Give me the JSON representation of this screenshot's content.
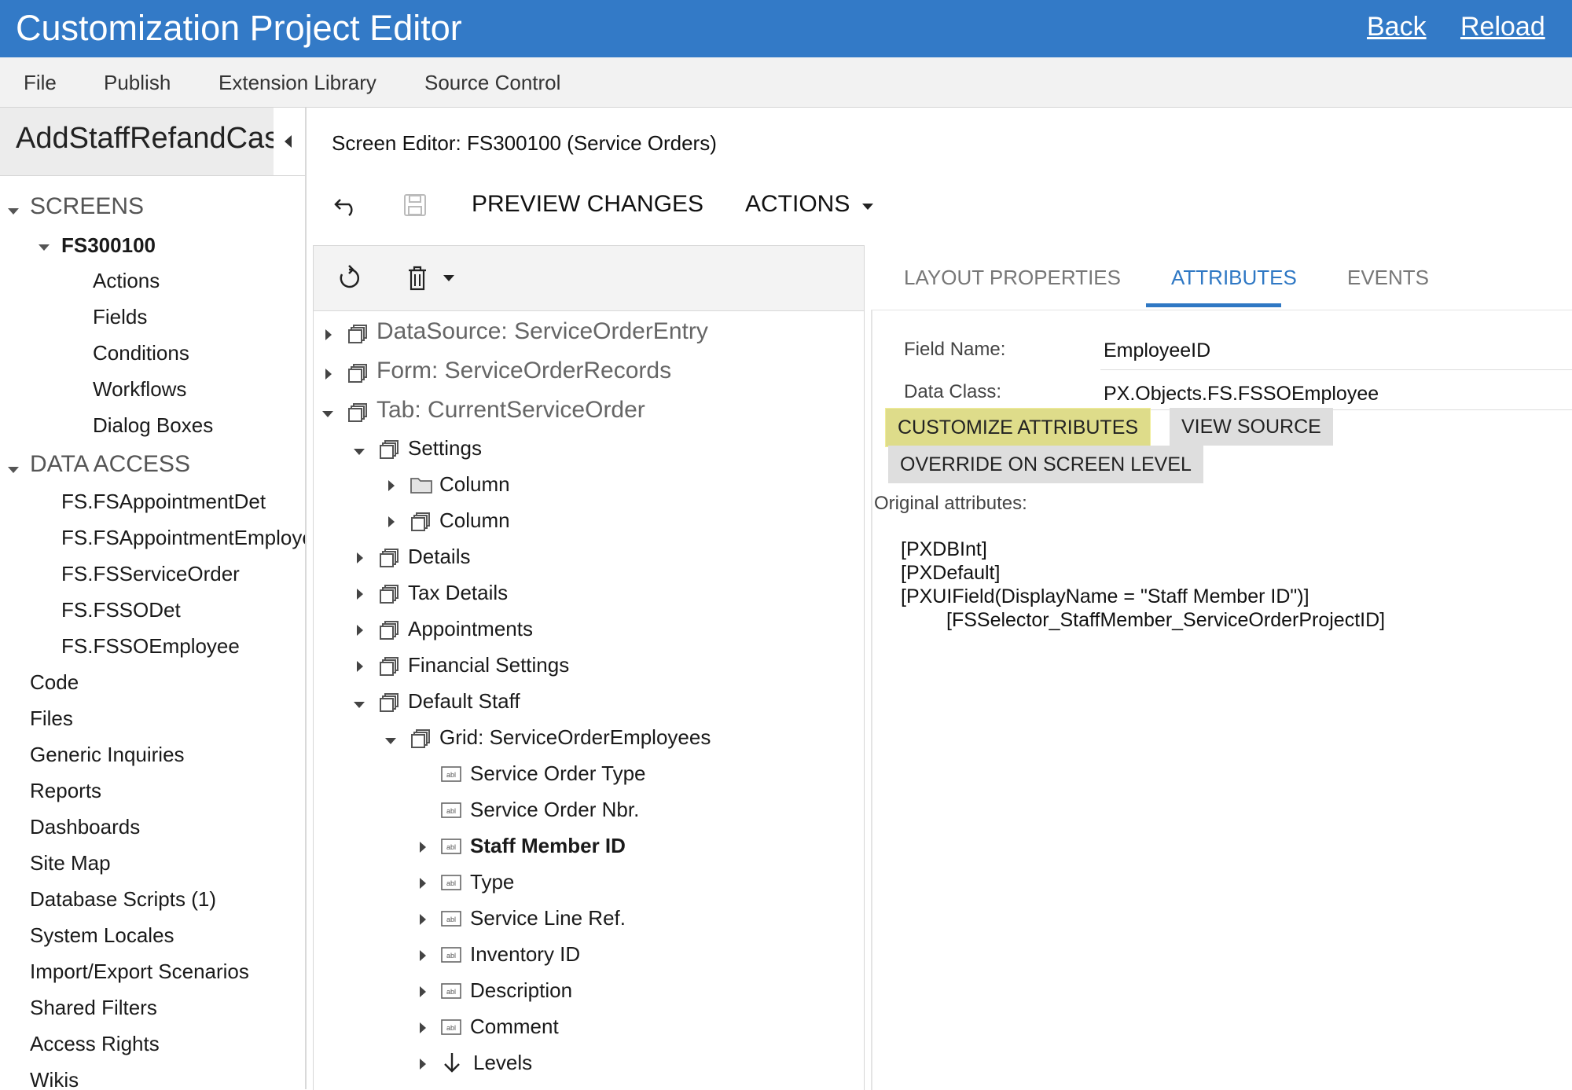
{
  "header": {
    "title": "Customization Project Editor",
    "back_label": "Back",
    "reload_label": "Reload"
  },
  "menu": {
    "items": [
      "File",
      "Publish",
      "Extension Library",
      "Source Control"
    ]
  },
  "left_panel": {
    "project_name": "AddStaffRefandCase",
    "screens_label": "SCREENS",
    "screen_id": "FS300100",
    "screen_children": [
      "Actions",
      "Fields",
      "Conditions",
      "Workflows",
      "Dialog Boxes"
    ],
    "data_access_label": "DATA ACCESS",
    "data_access_items": [
      "FS.FSAppointmentDet",
      "FS.FSAppointmentEmployee",
      "FS.FSServiceOrder",
      "FS.FSSODet",
      "FS.FSSOEmployee"
    ],
    "other_items": [
      "Code",
      "Files",
      "Generic Inquiries",
      "Reports",
      "Dashboards",
      "Site Map",
      "Database Scripts (1)",
      "System Locales",
      "Import/Export Scenarios",
      "Shared Filters",
      "Access Rights",
      "Wikis"
    ]
  },
  "editor": {
    "screen_title": "Screen Editor: FS300100 (Service Orders)",
    "preview_label": "PREVIEW CHANGES",
    "actions_label": "ACTIONS"
  },
  "tree": {
    "datasource": "DataSource: ServiceOrderEntry",
    "form": "Form: ServiceOrderRecords",
    "tab": "Tab: CurrentServiceOrder",
    "settings": "Settings",
    "column1": "Column",
    "column2": "Column",
    "details": "Details",
    "tax_details": "Tax Details",
    "appointments": "Appointments",
    "financial_settings": "Financial Settings",
    "default_staff": "Default Staff",
    "grid": "Grid: ServiceOrderEmployees",
    "fields": [
      "Service Order Type",
      "Service Order Nbr.",
      "Staff Member ID",
      "Type",
      "Service Line Ref.",
      "Inventory ID",
      "Description",
      "Comment",
      "Levels"
    ]
  },
  "properties": {
    "tabs": [
      "LAYOUT PROPERTIES",
      "ATTRIBUTES",
      "EVENTS"
    ],
    "field_name_label": "Field Name:",
    "field_name_value": "EmployeeID",
    "data_class_label": "Data Class:",
    "data_class_value": "PX.Objects.FS.FSSOEmployee",
    "customize_label": "CUSTOMIZE ATTRIBUTES",
    "view_source_label": "VIEW SOURCE",
    "override_label": "OVERRIDE ON SCREEN LEVEL",
    "original_label": "Original attributes:",
    "attributes": [
      "[PXDBInt]",
      "[PXDefault]",
      "[PXUIField(DisplayName = \"Staff Member ID\")]",
      "[FSSelector_StaffMember_ServiceOrderProjectID]"
    ]
  },
  "colors": {
    "header_bg": "#337ac7",
    "accent": "#2f78c4",
    "highlight": "#dedc8a"
  }
}
